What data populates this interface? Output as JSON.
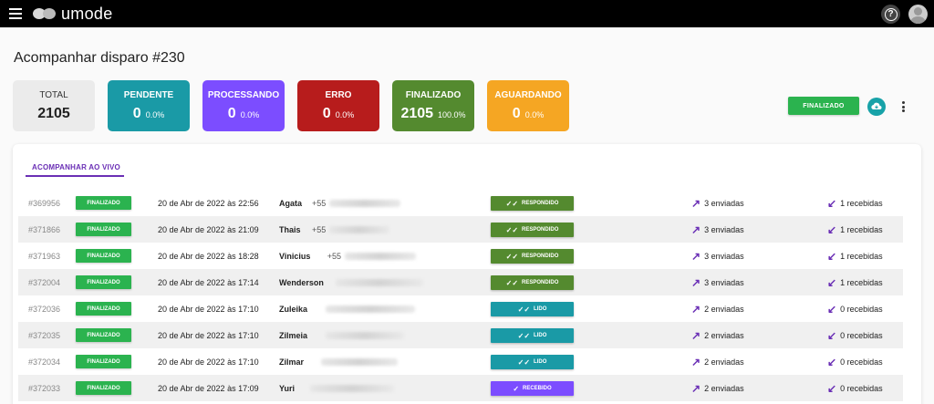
{
  "app": {
    "logo_text": "umode"
  },
  "page": {
    "title": "Acompanhar disparo #230"
  },
  "stats": {
    "total": {
      "label": "TOTAL",
      "value": "2105"
    },
    "pendente": {
      "label": "PENDENTE",
      "value": "0",
      "pct": "0.0%",
      "color": "#1a9aa6"
    },
    "processando": {
      "label": "PROCESSANDO",
      "value": "0",
      "pct": "0.0%",
      "color": "#7c4dff"
    },
    "erro": {
      "label": "ERRO",
      "value": "0",
      "pct": "0.0%",
      "color": "#b71c1c"
    },
    "finalizado": {
      "label": "FINALIZADO",
      "value": "2105",
      "pct": "100.0%",
      "color": "#548a2f"
    },
    "aguardando": {
      "label": "AGUARDANDO",
      "value": "0",
      "pct": "0.0%",
      "color": "#f5a623"
    }
  },
  "actions": {
    "finalizado_button": "FINALIZADO"
  },
  "tabs": {
    "live": "ACOMPANHAR AO VIVO"
  },
  "rows": [
    {
      "id": "#369956",
      "status": "FINALIZADO",
      "date": "20 de Abr de 2022 às 22:56",
      "name": "Agata",
      "phone_prefix": "+55",
      "response": "RESPONDIDO",
      "response_color": "#548a2f",
      "sent": "3 enviadas",
      "received": "1 recebidas"
    },
    {
      "id": "#371866",
      "status": "FINALIZADO",
      "date": "20 de Abr de 2022 às 21:09",
      "name": "Thais",
      "phone_prefix": "+55",
      "response": "RESPONDIDO",
      "response_color": "#548a2f",
      "sent": "3 enviadas",
      "received": "1 recebidas"
    },
    {
      "id": "#371963",
      "status": "FINALIZADO",
      "date": "20 de Abr de 2022 às 18:28",
      "name": "Vinicius",
      "phone_prefix": "+55",
      "response": "RESPONDIDO",
      "response_color": "#548a2f",
      "sent": "3 enviadas",
      "received": "1 recebidas"
    },
    {
      "id": "#372004",
      "status": "FINALIZADO",
      "date": "20 de Abr de 2022 às 17:14",
      "name": "Wenderson",
      "phone_prefix": "",
      "response": "RESPONDIDO",
      "response_color": "#548a2f",
      "sent": "3 enviadas",
      "received": "1 recebidas"
    },
    {
      "id": "#372036",
      "status": "FINALIZADO",
      "date": "20 de Abr de 2022 às 17:10",
      "name": "Zuleika",
      "phone_prefix": "",
      "response": "LIDO",
      "response_color": "#1a9aa6",
      "sent": "2 enviadas",
      "received": "0 recebidas"
    },
    {
      "id": "#372035",
      "status": "FINALIZADO",
      "date": "20 de Abr de 2022 às 17:10",
      "name": "Zilmeia",
      "phone_prefix": "",
      "response": "LIDO",
      "response_color": "#1a9aa6",
      "sent": "2 enviadas",
      "received": "0 recebidas"
    },
    {
      "id": "#372034",
      "status": "FINALIZADO",
      "date": "20 de Abr de 2022 às 17:10",
      "name": "Zilmar",
      "phone_prefix": "",
      "response": "LIDO",
      "response_color": "#1a9aa6",
      "sent": "2 enviadas",
      "received": "0 recebidas"
    },
    {
      "id": "#372033",
      "status": "FINALIZADO",
      "date": "20 de Abr de 2022 às 17:09",
      "name": "Yuri",
      "phone_prefix": "",
      "response": "RECEBIDO",
      "response_color": "#7c4dff",
      "sent": "2 enviadas",
      "received": "0 recebidas"
    }
  ]
}
